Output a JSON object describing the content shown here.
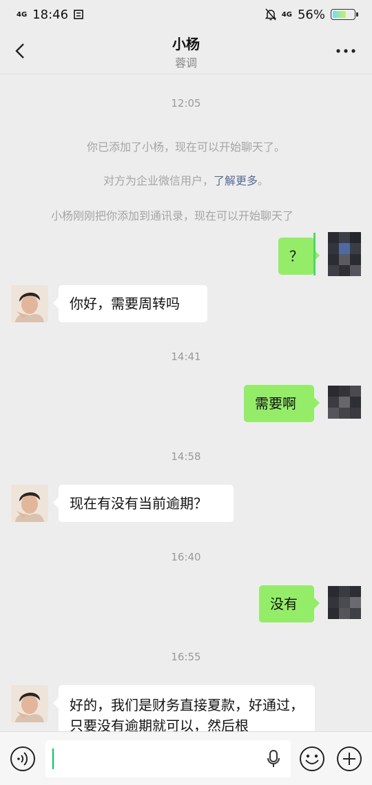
{
  "status": {
    "time": "18:46",
    "network_left": "4G",
    "network_right": "4G",
    "battery": "56%",
    "battery_level": 0.56
  },
  "header": {
    "title": "小杨",
    "subtitle": "蓉调"
  },
  "chat": {
    "ts1": "12:05",
    "sys1": "你已添加了小杨，现在可以开始聊天了。",
    "sys2_text": "对方为企业微信用户，",
    "sys2_link": "了解更多",
    "sys2_end": "。",
    "sys3": "小杨刚刚把你添加到通讯录，现在可以开始聊天了",
    "msg1": "？",
    "msg2": "你好，需要周转吗",
    "ts2": "14:41",
    "msg3": "需要啊",
    "ts3": "14:58",
    "msg4": "现在有没有当前逾期？",
    "ts4": "16:40",
    "msg5": "没有",
    "ts5": "16:55",
    "msg6": "好的，我们是财务直接夏款，好通过，只要没有逾期就可以，然后根"
  },
  "colors": {
    "out_bubble": "#95ec69",
    "in_bubble": "#ffffff",
    "link": "#576b95",
    "background": "#ededed"
  },
  "icons": {
    "back": "chevron-left-icon",
    "more": "more-dots-icon",
    "voice": "voice-icon",
    "mic": "mic-icon",
    "emoji": "emoji-icon",
    "plus": "plus-icon"
  }
}
